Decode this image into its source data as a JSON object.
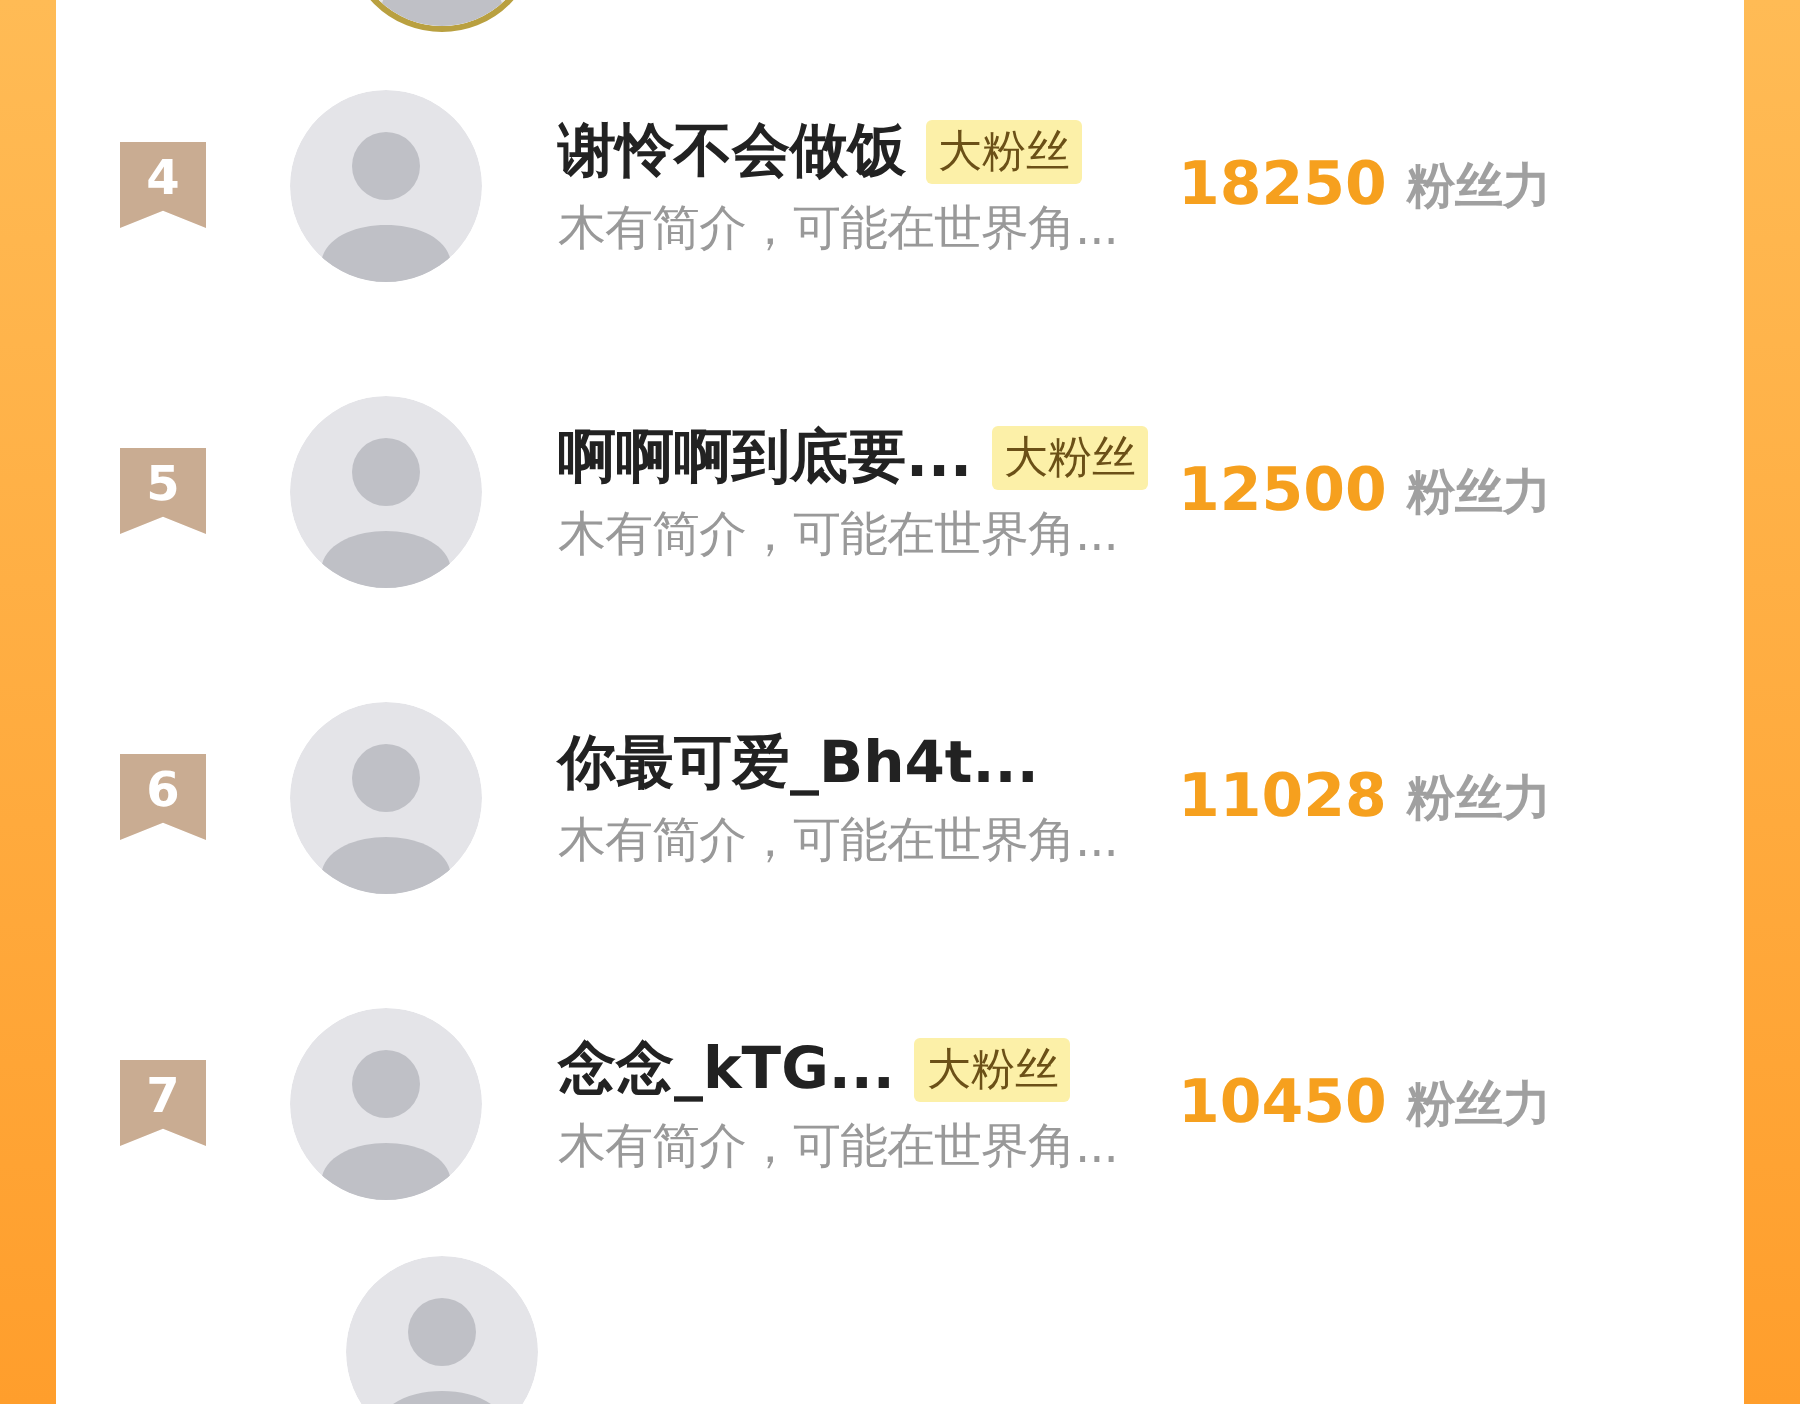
{
  "rows": [
    {
      "rank": "4",
      "name": "谢怜不会做饭",
      "badge": "大粉丝",
      "intro": "木有简介，可能在世界角...",
      "score": "18250",
      "unit": "粉丝力"
    },
    {
      "rank": "5",
      "name": "啊啊啊到底要...",
      "badge": "大粉丝",
      "intro": "木有简介，可能在世界角...",
      "score": "12500",
      "unit": "粉丝力"
    },
    {
      "rank": "6",
      "name": "你最可爱_Bh4t...",
      "intro": "木有简介，可能在世界角...",
      "score": "11028",
      "unit": "粉丝力"
    },
    {
      "rank": "7",
      "name": "念念_kTG...",
      "badge": "大粉丝",
      "intro": "木有简介，可能在世界角...",
      "score": "10450",
      "unit": "粉丝力"
    }
  ]
}
